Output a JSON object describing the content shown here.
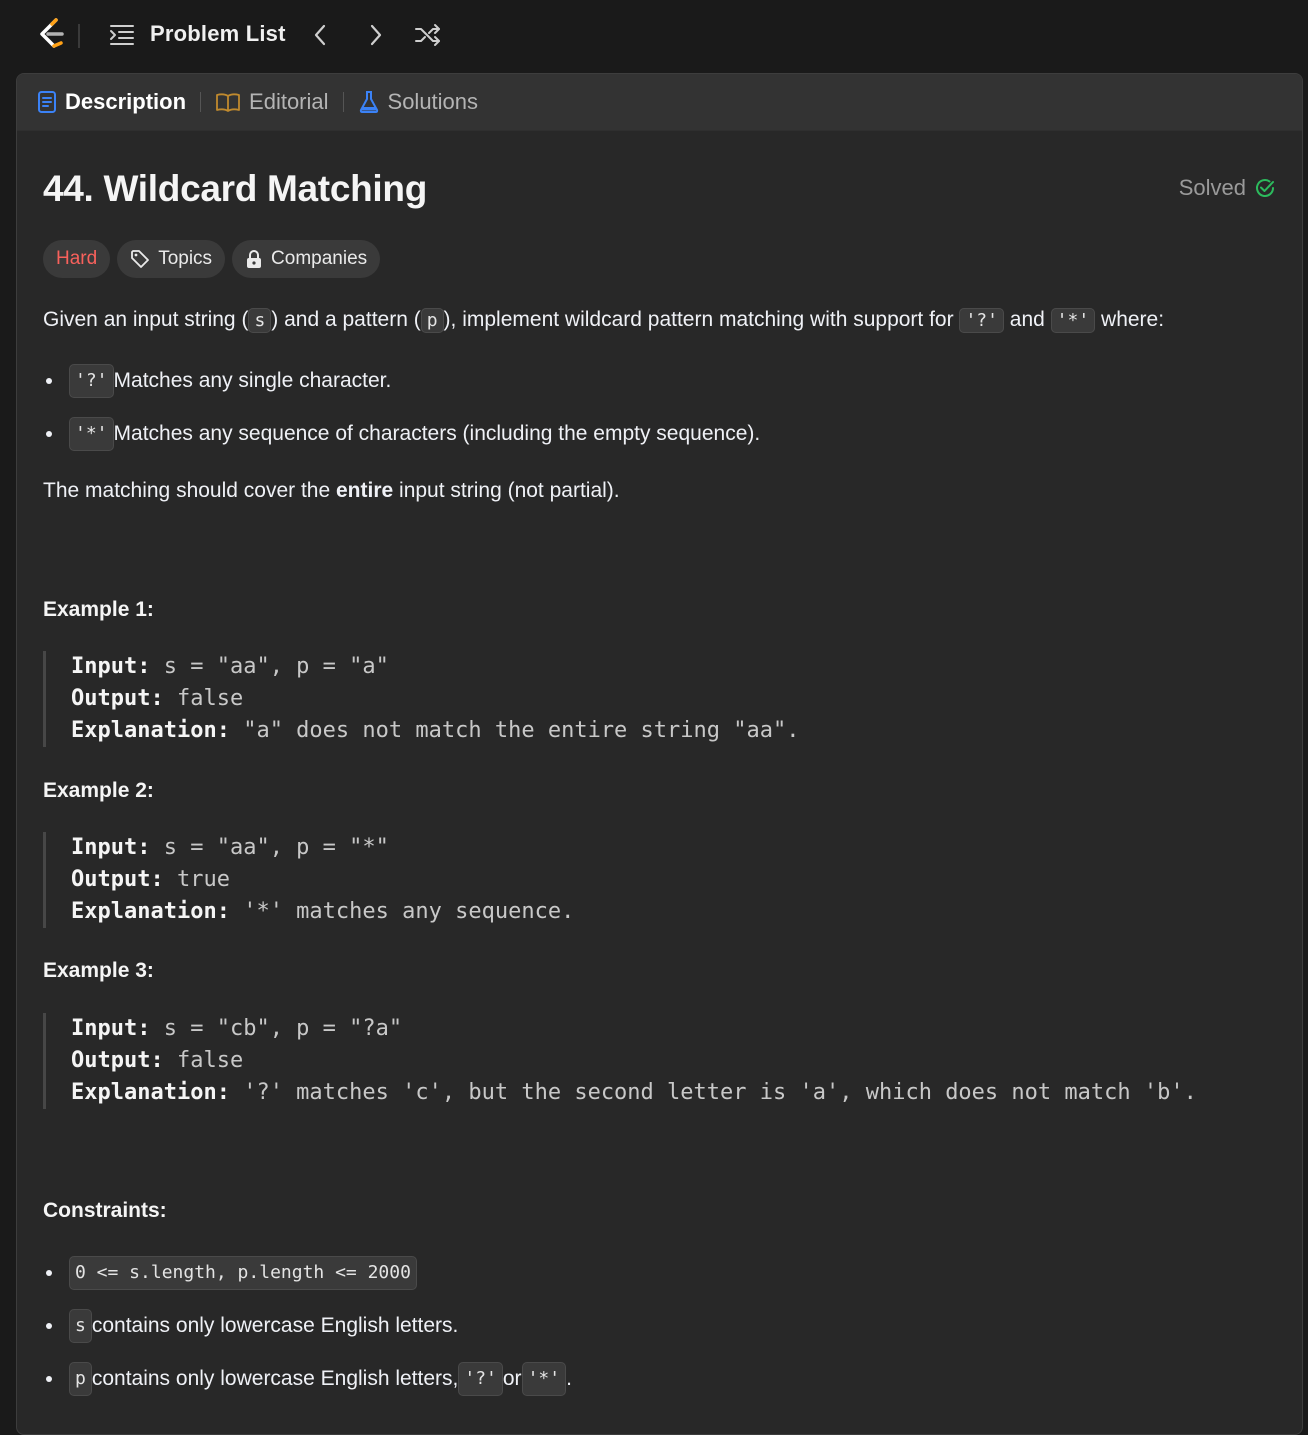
{
  "topbar": {
    "problem_list_label": "Problem List"
  },
  "tabs": [
    {
      "label": "Description",
      "icon": "document-icon",
      "color": "#3b82f6"
    },
    {
      "label": "Editorial",
      "icon": "book-icon",
      "color": "#c08a2e"
    },
    {
      "label": "Solutions",
      "icon": "flask-icon",
      "color": "#3b82f6"
    }
  ],
  "problem": {
    "title": "44. Wildcard Matching",
    "status": "Solved",
    "status_color": "#2cbb5d",
    "difficulty": "Hard",
    "difficulty_color": "#f8615c",
    "topics_label": "Topics",
    "companies_label": "Companies"
  },
  "description": {
    "p1_a": "Given an input string (",
    "p1_code_s": "s",
    "p1_b": ") and a pattern (",
    "p1_code_p": "p",
    "p1_c": "), implement wildcard pattern matching with support for ",
    "p1_code_q": "'?'",
    "p1_d": " and ",
    "p1_code_star": "'*'",
    "p1_e": " where:",
    "rules": [
      {
        "code": "'?'",
        "text": " Matches any single character."
      },
      {
        "code": "'*'",
        "text": " Matches any sequence of characters (including the empty sequence)."
      }
    ],
    "p2_a": "The matching should cover the ",
    "p2_bold": "entire",
    "p2_b": " input string (not partial)."
  },
  "examples": [
    {
      "heading": "Example 1:",
      "input_label": "Input:",
      "input": " s = \"aa\", p = \"a\"",
      "output_label": "Output:",
      "output": " false",
      "explanation_label": "Explanation:",
      "explanation": " \"a\" does not match the entire string \"aa\"."
    },
    {
      "heading": "Example 2:",
      "input_label": "Input:",
      "input": " s = \"aa\", p = \"*\"",
      "output_label": "Output:",
      "output": " true",
      "explanation_label": "Explanation:",
      "explanation": " '*' matches any sequence."
    },
    {
      "heading": "Example 3:",
      "input_label": "Input:",
      "input": " s = \"cb\", p = \"?a\"",
      "output_label": "Output:",
      "output": " false",
      "explanation_label": "Explanation:",
      "explanation": " '?' matches 'c', but the second letter is 'a', which does not match 'b'."
    }
  ],
  "constraints": {
    "heading": "Constraints:",
    "c1_code": "0 <= s.length, p.length <= 2000",
    "c2_code": "s",
    "c2_text": " contains only lowercase English letters.",
    "c3_code": "p",
    "c3_text": " contains only lowercase English letters, ",
    "c3_code_q": "'?'",
    "c3_or": " or ",
    "c3_code_star": "'*'",
    "c3_end": "."
  }
}
